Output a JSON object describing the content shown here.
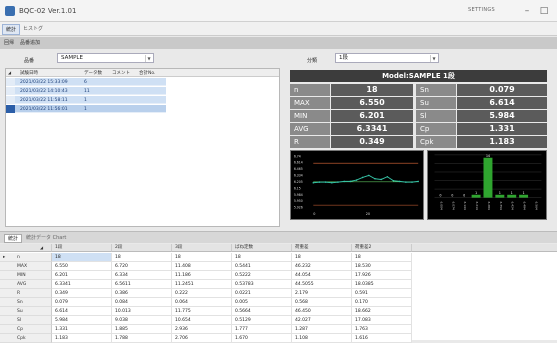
{
  "window": {
    "title": "BQC-02 Ver.1.01",
    "settings_label": "SETTINGS",
    "minimize_glyph": "–",
    "maximize_glyph": "□"
  },
  "menu": {
    "items": [
      "統計",
      "ヒストグ"
    ]
  },
  "subtabs": {
    "items": [
      "回帰",
      "品番追加"
    ]
  },
  "filter": {
    "product_label": "品番",
    "product_value": "SAMPLE",
    "type_label": "分類",
    "type_value": "1段"
  },
  "records": {
    "columns": [
      "試験日時",
      "データ数",
      "コメント",
      "合計No."
    ],
    "rows": [
      {
        "date": "2021/03/22 15:33:09",
        "count": "6"
      },
      {
        "date": "2021/03/22 14:10:43",
        "count": "11"
      },
      {
        "date": "2021/03/22 11:58:11",
        "count": "1"
      },
      {
        "date": "2021/03/22 11:56:01",
        "count": "1"
      }
    ]
  },
  "model_bar": "Model:SAMPLE 1段",
  "stats": {
    "left": [
      {
        "label": "n",
        "value": "18"
      },
      {
        "label": "MAX",
        "value": "6.550"
      },
      {
        "label": "MIN",
        "value": "6.201"
      },
      {
        "label": "AVG",
        "value": "6.3341"
      },
      {
        "label": "R",
        "value": "0.349"
      }
    ],
    "right": [
      {
        "label": "Sn",
        "value": "0.079"
      },
      {
        "label": "Su",
        "value": "6.614"
      },
      {
        "label": "Sl",
        "value": "5.984"
      },
      {
        "label": "Cp",
        "value": "1.331"
      },
      {
        "label": "Cpk",
        "value": "1.183"
      }
    ]
  },
  "chart_data": [
    {
      "type": "line",
      "ylim": [
        5.98,
        6.68
      ],
      "y_ticks": [
        "6.74",
        "6.614",
        "6.465",
        "6.334",
        "6.205",
        "6.15",
        "5.984",
        "5.950",
        "5.926"
      ],
      "x_ticks": [
        "0",
        "20"
      ],
      "series": [
        {
          "values": [
            6.32,
            6.33,
            6.33,
            6.32,
            6.33,
            6.34,
            6.34,
            6.36,
            6.4,
            6.43,
            6.38,
            6.37,
            6.41,
            6.35,
            6.34,
            6.33,
            6.33,
            6.34
          ]
        }
      ],
      "reference_lines": [
        6.614,
        5.984,
        6.334
      ],
      "colors": {
        "background": "#000000",
        "series": "#36c3a6",
        "limit": "#e06a3a",
        "center": "#5cc05c"
      }
    },
    {
      "type": "bar",
      "categories": [
        "6.004",
        "6.074",
        "6.144",
        "6.214",
        "6.284",
        "6.354",
        "6.424",
        "6.494",
        "6.564"
      ],
      "values": [
        0,
        0,
        0,
        1,
        14,
        1,
        1,
        1,
        0
      ],
      "value_labels": [
        "0",
        "0",
        "0",
        "1",
        "14",
        "1",
        "1",
        "1",
        ""
      ],
      "ylim": [
        0,
        15
      ],
      "colors": {
        "background": "#000000",
        "bar": "#2fa52f"
      }
    }
  ],
  "bottom": {
    "tabs": [
      "統計",
      "統計データ Chart"
    ],
    "columns": [
      "1段",
      "2段",
      "3段",
      "ばね定数",
      "荷重差",
      "荷重差2"
    ],
    "rows": [
      {
        "key": "▸",
        "label": "n",
        "values": [
          "18",
          "18",
          "18",
          "18",
          "18",
          "18"
        ]
      },
      {
        "key": "",
        "label": "MAX",
        "values": [
          "6.550",
          "6.720",
          "11.408",
          "0.5441",
          "46.232",
          "18.530"
        ]
      },
      {
        "key": "",
        "label": "MIN",
        "values": [
          "6.201",
          "6.334",
          "11.186",
          "0.5222",
          "44.054",
          "17.926"
        ]
      },
      {
        "key": "",
        "label": "AVG",
        "values": [
          "6.3341",
          "6.5611",
          "11.2451",
          "0.53783",
          "44.5055",
          "18.0385"
        ]
      },
      {
        "key": "",
        "label": "R",
        "values": [
          "0.349",
          "0.386",
          "0.222",
          "0.0221",
          "2.179",
          "0.591"
        ]
      },
      {
        "key": "",
        "label": "Sn",
        "values": [
          "0.079",
          "0.084",
          "0.064",
          "0.005",
          "0.568",
          "0.170"
        ]
      },
      {
        "key": "",
        "label": "Su",
        "values": [
          "6.614",
          "10.013",
          "11.775",
          "0.5664",
          "46.450",
          "18.662"
        ]
      },
      {
        "key": "",
        "label": "Sl",
        "values": [
          "5.984",
          "9.038",
          "10.654",
          "0.5129",
          "42.027",
          "17.083"
        ]
      },
      {
        "key": "",
        "label": "Cp",
        "values": [
          "1.331",
          "1.885",
          "2.936",
          "1.777",
          "1.287",
          "1.763"
        ]
      },
      {
        "key": "",
        "label": "Cpk",
        "values": [
          "1.183",
          "1.788",
          "2.706",
          "1.670",
          "1.108",
          "1.616"
        ]
      }
    ]
  }
}
